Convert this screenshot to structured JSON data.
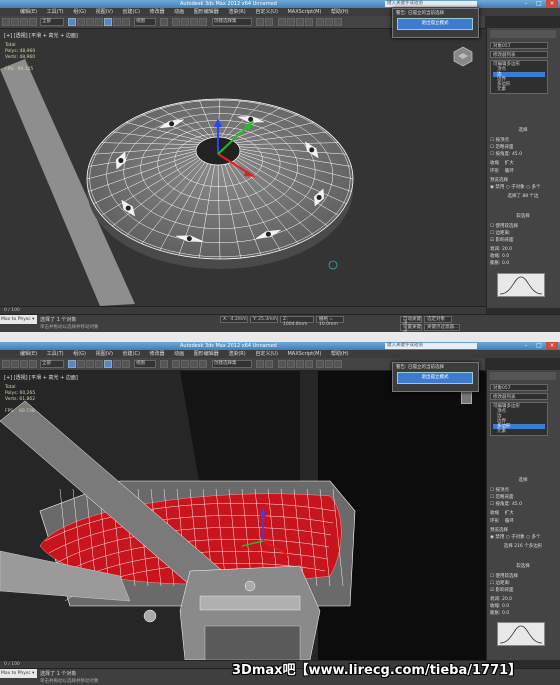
{
  "app": {
    "title": "Autodesk 3ds Max 2012    x64 Unnamed",
    "search_placeholder": "键入关键字或短语",
    "menu": [
      "编辑(E)",
      "工具(T)",
      "组(G)",
      "视图(V)",
      "创建(C)",
      "修改器",
      "动画",
      "图形编辑器",
      "渲染(R)",
      "自定义(U)",
      "MAXScript(M)",
      "帮助(H)"
    ],
    "selection_filter": "全部",
    "view_dropdown": "视图",
    "named_set": "创建选择集"
  },
  "dialog": {
    "title": "警告: 已孤立的当前选择",
    "button": "退出孤立模式"
  },
  "viewport1": {
    "label": "[+] [透视] [平滑 + 高光 + 边面]",
    "stats": "Total\nPolys: 48,960\nVerts: 48,960\n\nFPS:  99.105"
  },
  "viewport2": {
    "label": "[+] [透视] [平滑 + 高光 + 边面]",
    "stats": "Total\nPolys: 60,265\nVerts: 61,862\n\nFPS:   60.738"
  },
  "command_panel": {
    "object_name": "对象057",
    "modifier_list": "修改器列表",
    "stack": [
      "可编辑多边形",
      "顶点",
      "边",
      "边界",
      "多边形",
      "元素"
    ],
    "selected_stack_1": "边",
    "selected_stack_2": "多边形",
    "selection_title": "选择",
    "by_vertex": "按顶点",
    "ignore_backfacing": "忽略背面",
    "by_angle": "按角度:",
    "angle_value": "45.0",
    "shrink": "收缩",
    "grow": "扩大",
    "ring": "环形",
    "loop": "循环",
    "preview": "预览选择",
    "disabled": "禁用",
    "subobject": "子对象",
    "multi": "多个",
    "selected_1": "选择了 88 个边",
    "selected_2": "选择 216 个多边形",
    "soft_title": "软选择",
    "use_soft": "使用软选择",
    "edge_distance": "边距离:",
    "affect_back": "影响背面",
    "falloff": "衰减:",
    "pinch": "收缩:",
    "bubble": "膨胀:",
    "falloff_v": "20.0",
    "pinch_v": "0.0",
    "bubble_v": "0.0"
  },
  "status": {
    "script_label": "Max to Physc ▾",
    "message1": "选择了 1 个对象",
    "sub1": "单击并拖动以选择并移动对象",
    "message2": "选择了 1 个对象",
    "sub2": "单击并拖动以选择并移动对象",
    "x": "X: -4.2mm",
    "y": "Y: 25.3mm",
    "z": "Z: 1004.8mm",
    "grid": "栅格 = 10.0mm",
    "autokey": "自动关键点",
    "selected": "选定对象",
    "setkey": "设置关键点",
    "keyfilter": "关键点过滤器...",
    "timeline": "0 / 100",
    "time_tag": "添加时间标记"
  },
  "watermark": "3Dmax吧【www.lirecg.com/tieba/1771】",
  "colors": {
    "accent": "#3d7bd2",
    "viewport_bg": "#303030",
    "wire": "#ffffff",
    "selected_faces": "#c8141c"
  }
}
